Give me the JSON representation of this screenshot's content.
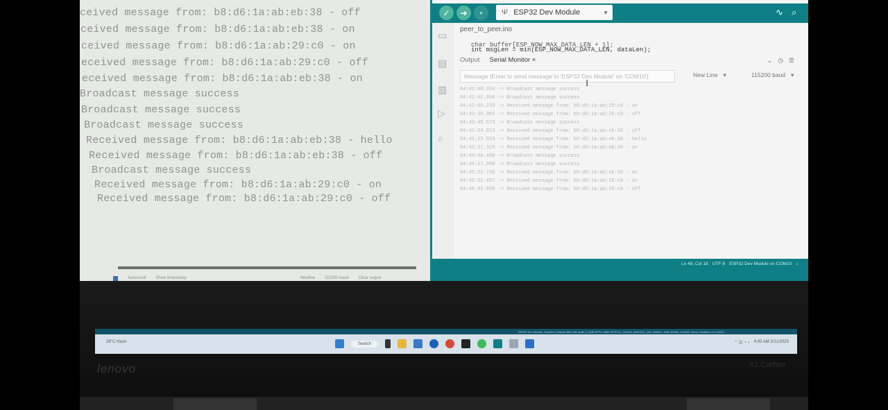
{
  "terminal": {
    "lines": [
      "ceived message from: b8:d6:1a:ab:eb:38 - off",
      "ceived message from: b8:d6:1a:ab:eb:38 - on",
      "ceived message from: b8:d6:1a:ab:29:c0 - on",
      "eceived message from: b8:d6:1a:ab:29:c0 - off",
      "eceived message from: b8:d6:1a:ab:eb:38 - on",
      "Broadcast message success",
      "Broadcast message success",
      "Broadcast message success",
      "Received message from: b8:d6:1a:ab:eb:38 - hello",
      "Received message from: b8:d6:1a:ab:eb:38 - off",
      "Broadcast message success",
      "Received message from: b8:d6:1a:ab:29:c0 - on",
      "Received message from: b8:d6:1a:ab:29:c0 - off"
    ],
    "status": {
      "autoscroll": "Autoscroll",
      "timestamp": "Show timestamp",
      "newline": "Newline",
      "baud": "115200 baud",
      "clear": "Clear output"
    }
  },
  "ide": {
    "board": "ESP32 Dev Module",
    "file_tab": "peer_to_peer.ino",
    "code_line_1": "char buffer[ESP_NOW_MAX_DATA_LEN + 1];",
    "code_line_2": "int msgLen = min(ESP_NOW_MAX_DATA_LEN, dataLen);",
    "panel_tabs": {
      "output": "Output",
      "serial": "Serial Monitor",
      "close": "×"
    },
    "message_placeholder": "Message (Enter to send message to 'ESP32 Dev Module' on 'COM10')",
    "line_ending": "New Line",
    "baud": "115200 baud",
    "serial_lines": [
      "04:41:48.334 -> Broadcast message success",
      "04:41:41.950 -> Broadcast message success",
      "04:42:05.233 -> Received message from: b8:d6:1a:ab:29:c0 - on",
      "04:42:30.303 -> Received message from: b8:d6:1a:ab:29:c0 - off",
      "04:42:45.573 -> Broadcast message success",
      "04:42:54.013 -> Received message from: b8:d6:1a:ab:eb:38 - off",
      "04:43:15.933 -> Received message from: b8:d6:1a:ab:eb:38 - hello",
      "04:43:31.329 -> Received message from: b8:d6:1a:ab:eb:38 - on",
      "04:43:40.400 -> Broadcast message success",
      "04:44:17.098 -> Broadcast message success",
      "04:45:23.736 -> Received message from: b8:d6:1a:ab:eb:38 - on",
      "04:45:31.457 -> Received message from: b8:d6:1a:ab:29:c0 - on",
      "04:45:41.856 -> Received message from: b8:d6:1a:ab:29:c0 - off"
    ],
    "status_bar": {
      "position": "Ln 49, Col 18",
      "encoding": "UTF-8",
      "board_port": "ESP32 Dev Module on COM10"
    }
  },
  "taskbar": {
    "header": "ESP32 Dev Module, Disabled, Default 4MB with spiffs (1.2MB APP/1.5MB SPIFFS), 240MHz (WiFi/BT), QIO, 80MHz, 4MB (32Mb), 921600, None, Disabled on COM10",
    "weather": "28°C Haze",
    "search": "Search",
    "time": "4:45 AM",
    "date": "2/21/2023"
  },
  "laptop": {
    "brand": "lenovo",
    "model": "X1 Carbon"
  },
  "colors": {
    "ide_teal": "#0e7f84",
    "terminal_bg": "#e7e9e6",
    "desktop": "#0f7f85"
  }
}
